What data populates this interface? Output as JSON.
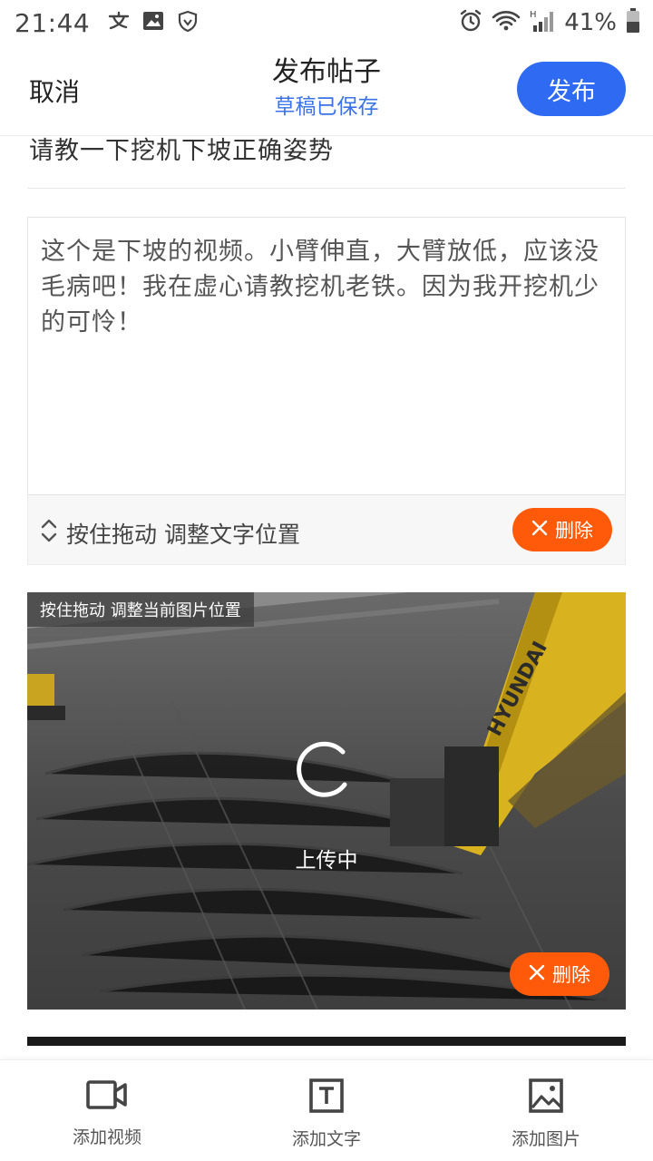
{
  "status_bar": {
    "time": "21:44",
    "battery": "41%",
    "left_icons": [
      "alipay-icon",
      "image-icon",
      "shield-icon"
    ],
    "right_icons": [
      "alarm-icon",
      "wifi-icon",
      "signal-icon",
      "battery-icon"
    ]
  },
  "header": {
    "cancel_label": "取消",
    "title": "发布帖子",
    "subtitle": "草稿已保存",
    "publish_label": "发布"
  },
  "post": {
    "title": "请教一下挖机下坡正确姿势",
    "body": "这个是下坡的视频。小臂伸直，大臂放低，应该没毛病吧！我在虚心请教挖机老铁。因为我开挖机少的可怜！",
    "drag_hint": "按住拖动 调整文字位置",
    "delete_label": "删除"
  },
  "image": {
    "drag_hint": "按住拖动 调整当前图片位置",
    "status": "上传中",
    "delete_label": "删除",
    "brand_text": "HYUNDAI"
  },
  "bottom_bar": {
    "items": [
      {
        "label": "添加视频",
        "icon": "video-camera-icon"
      },
      {
        "label": "添加文字",
        "icon": "text-icon"
      },
      {
        "label": "添加图片",
        "icon": "image-icon"
      }
    ]
  },
  "colors": {
    "accent_blue": "#2f6bf2",
    "subtitle_blue": "#3a73e8",
    "delete_orange": "#ff5a0a"
  }
}
